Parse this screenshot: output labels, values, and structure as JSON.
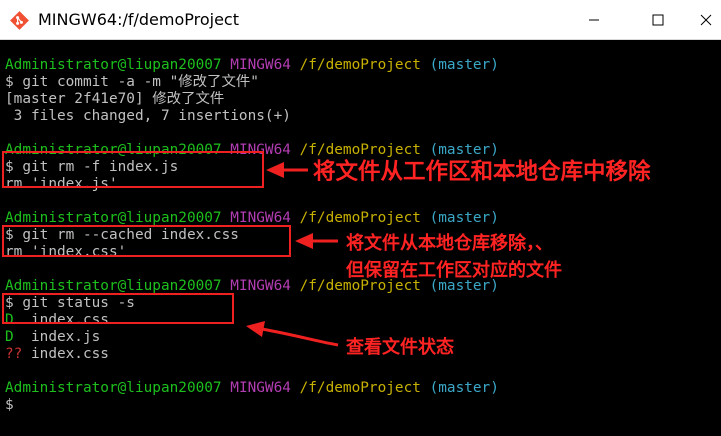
{
  "window": {
    "title": "MINGW64:/f/demoProject"
  },
  "prompt": {
    "user": "Administrator@liupan20007",
    "env": "MINGW64",
    "path": "/f/demoProject",
    "branch": "(master)",
    "symbol": "$"
  },
  "session": {
    "cmd1": "$ git commit -a -m \"修改了文件\"",
    "out1a": "[master 2f41e70] 修改了文件",
    "out1b": " 3 files changed, 7 insertions(+)",
    "cmd2": "$ git rm -f index.js",
    "out2": "rm 'index.js'",
    "cmd3": "$ git rm --cached index.css",
    "out3": "rm 'index.css'",
    "cmd4": "$ git status -s",
    "status_rows": [
      {
        "code": "D ",
        "file": " index.css"
      },
      {
        "code": "D ",
        "file": " index.js"
      },
      {
        "code": "??",
        "file": " index.css"
      }
    ]
  },
  "annotations": {
    "a1": "将文件从工作区和本地仓库中移除",
    "a2_line1": "将文件从本地仓库移除，、",
    "a2_line2": "但保留在工作区对应的文件",
    "a3": "查看文件状态"
  },
  "colors": {
    "user": "#1dbf1d",
    "mingw": "#b23db2",
    "path": "#c7b100",
    "branch": "#3ba8c8",
    "annotation": "#ff2323"
  }
}
